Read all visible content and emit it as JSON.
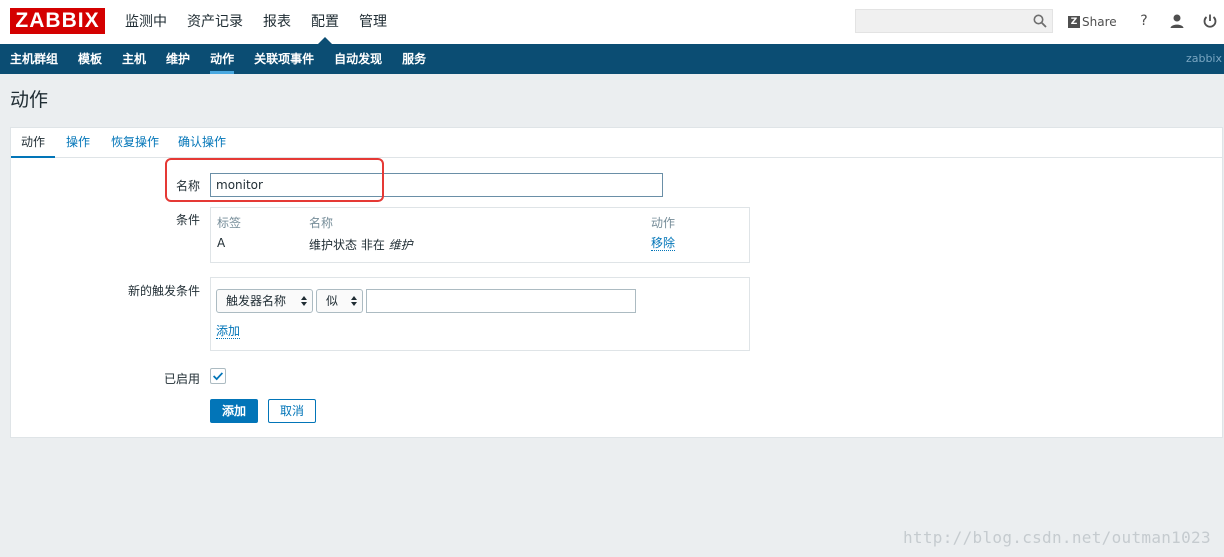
{
  "header": {
    "logo": "ZABBIX",
    "nav": [
      "监测中",
      "资产记录",
      "报表",
      "配置",
      "管理"
    ],
    "search_placeholder": "",
    "share_label": "Share",
    "share_icon_letter": "Z",
    "help_label": "?",
    "icons": [
      "search-icon",
      "help-icon",
      "user-icon",
      "power-icon"
    ]
  },
  "subnav": {
    "items": [
      "主机群组",
      "模板",
      "主机",
      "维护",
      "动作",
      "关联项事件",
      "自动发现",
      "服务"
    ],
    "active": "动作",
    "brand": "zabbix"
  },
  "page": {
    "title": "动作"
  },
  "tabs": [
    "动作",
    "操作",
    "恢复操作",
    "确认操作"
  ],
  "form": {
    "name_label": "名称",
    "name_value": "monitor",
    "conditions_label": "条件",
    "conditions_table": {
      "headers": [
        "标签",
        "名称",
        "动作"
      ],
      "rows": [
        {
          "tag": "A",
          "name_prefix": "维护状态 非在 ",
          "name_italic": "维护",
          "action": "移除"
        }
      ]
    },
    "new_condition_label": "新的触发条件",
    "new_condition_type": "触发器名称",
    "new_condition_operator": "似",
    "new_condition_value": "",
    "add_condition_link": "添加",
    "enabled_label": "已启用",
    "enabled_checked": true,
    "submit_label": "添加",
    "cancel_label": "取消"
  },
  "colors": {
    "brand_red": "#d40000",
    "subnav_blue": "#0b4d73",
    "link_blue": "#0275b8",
    "highlight_red": "#e53935"
  },
  "watermark": "http://blog.csdn.net/outman1023"
}
